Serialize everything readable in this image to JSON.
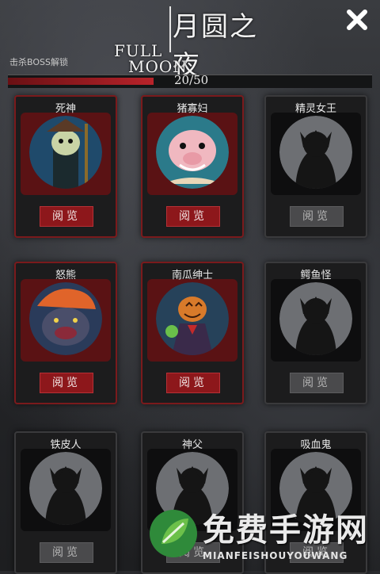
{
  "header": {
    "title_cn": "月圆之夜",
    "title_en_1": "FULL",
    "title_en_2": "MOON",
    "close_icon": "close-x-icon"
  },
  "unlock": {
    "label": "击杀BOSS解锁",
    "current": 20,
    "total": 50,
    "text": "20/50",
    "fill_fraction": 0.4
  },
  "bosses": [
    {
      "name": "死神",
      "button": "阅览",
      "unlocked": true,
      "portrait": "grim-reaper"
    },
    {
      "name": "猪寡妇",
      "button": "阅览",
      "unlocked": true,
      "portrait": "pig-widow"
    },
    {
      "name": "精灵女王",
      "button": "阅览",
      "unlocked": false,
      "portrait": "silhouette"
    },
    {
      "name": "怒熊",
      "button": "阅览",
      "unlocked": true,
      "portrait": "angry-bear"
    },
    {
      "name": "南瓜绅士",
      "button": "阅览",
      "unlocked": true,
      "portrait": "pumpkin-gentleman"
    },
    {
      "name": "鳄鱼怪",
      "button": "阅览",
      "unlocked": false,
      "portrait": "silhouette"
    },
    {
      "name": "铁皮人",
      "button": "阅览",
      "unlocked": false,
      "portrait": "silhouette"
    },
    {
      "name": "神父",
      "button": "阅览",
      "unlocked": false,
      "portrait": "silhouette"
    },
    {
      "name": "吸血鬼",
      "button": "阅览",
      "unlocked": false,
      "portrait": "silhouette"
    }
  ],
  "watermark": {
    "cn": "免费手游网",
    "en": "MIANFEISHOUYOUWANG"
  },
  "colors": {
    "accent_red": "#8d171b",
    "locked_gray": "#4a4a4c"
  }
}
